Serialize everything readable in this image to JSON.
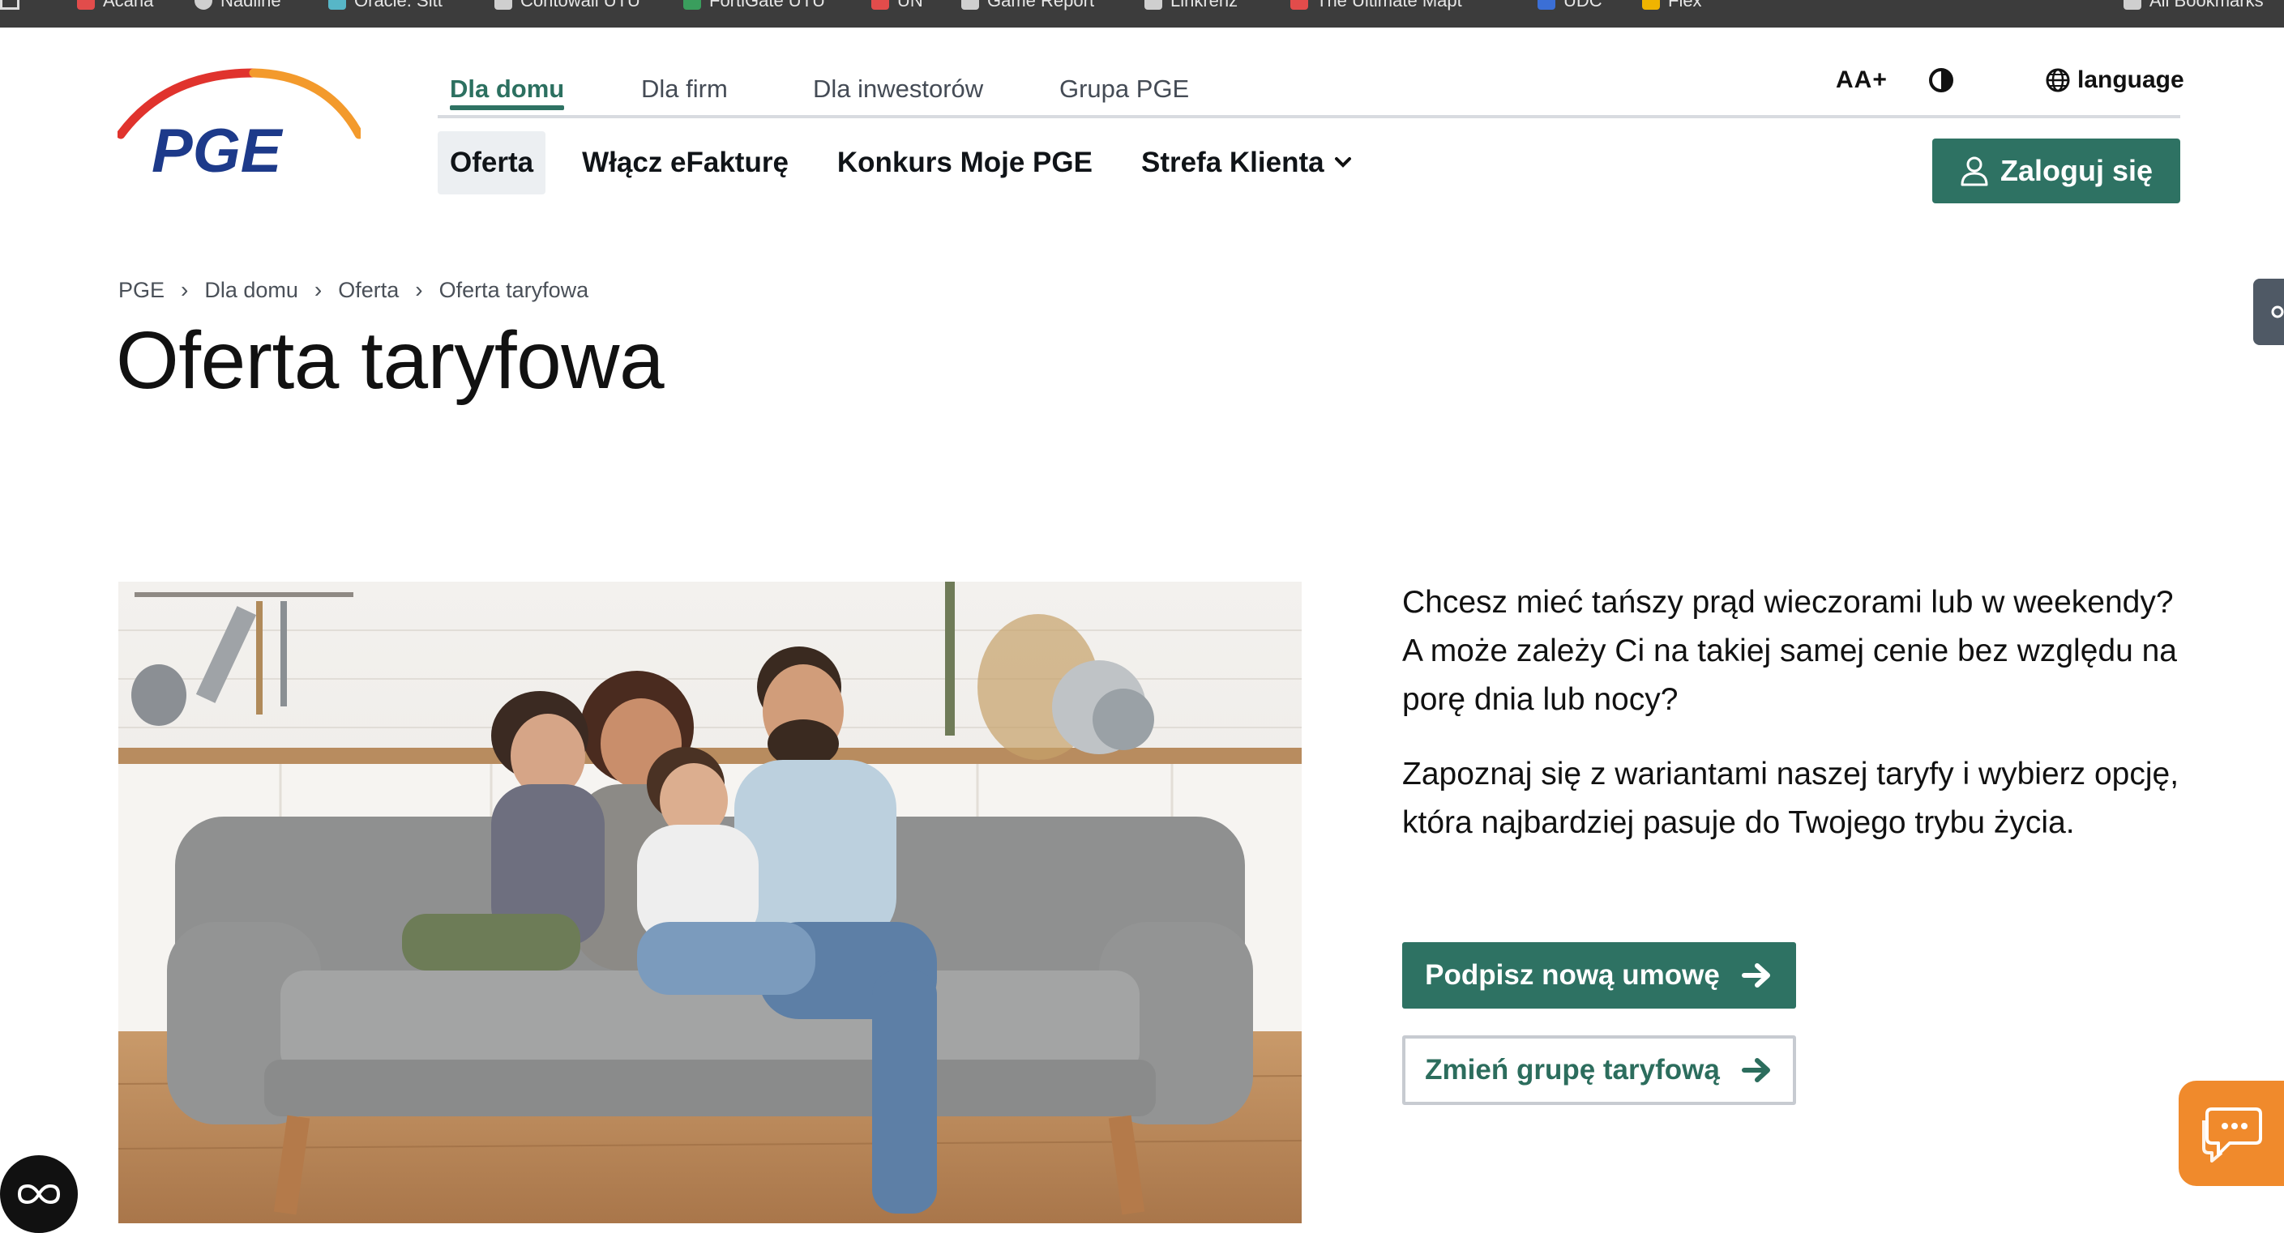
{
  "bookmarks": [
    {
      "label": "Acana",
      "color": "#e24c4b"
    },
    {
      "label": "Nadilne",
      "color": "#cfcfcf"
    },
    {
      "label": "Oracle. Sitt",
      "color": "#57b6c7"
    },
    {
      "label": "Contowall UTU",
      "color": "#cfcfcf"
    },
    {
      "label": "FortiGate UTU",
      "color": "#3a9e5d"
    },
    {
      "label": "UN",
      "color": "#e24c4b"
    },
    {
      "label": "Game Report",
      "color": "#cfcfcf"
    },
    {
      "label": "Linkrenz",
      "color": "#cfcfcf"
    },
    {
      "label": "The Ultimate Mapt",
      "color": "#e24c4b"
    },
    {
      "label": "UDC",
      "color": "#3b6fd6"
    },
    {
      "label": "Flex",
      "color": "#f0b400"
    },
    {
      "label": "All Bookmarks",
      "color": "#cfcfcf"
    }
  ],
  "logo": {
    "text": "PGE",
    "colors": {
      "arc_left": "#e0332d",
      "arc_right": "#f39a2c",
      "text": "#1d3a8a"
    }
  },
  "topnav": {
    "tabs": [
      {
        "label": "Dla domu",
        "active": true
      },
      {
        "label": "Dla firm",
        "active": false
      },
      {
        "label": "Dla inwestorów",
        "active": false
      },
      {
        "label": "Grupa PGE",
        "active": false
      }
    ]
  },
  "utility": {
    "font_size_label": "AA+",
    "language_label": "language"
  },
  "mainnav": {
    "items": [
      {
        "label": "Oferta",
        "selected": true
      },
      {
        "label": "Włącz eFakturę",
        "selected": false
      },
      {
        "label": "Konkurs Moje PGE",
        "selected": false
      },
      {
        "label": "Strefa Klienta",
        "selected": false,
        "dropdown": true
      }
    ]
  },
  "login_button": {
    "label": "Zaloguj się"
  },
  "breadcrumb": [
    "PGE",
    "Dla domu",
    "Oferta",
    "Oferta taryfowa"
  ],
  "page_title": "Oferta taryfowa",
  "intro": {
    "paragraph1": "Chcesz mieć tańszy prąd wieczorami lub w weekendy? A może zależy Ci na takiej samej cenie bez względu na porę dnia lub nocy?",
    "paragraph2": "Zapoznaj się z wariantami naszej taryfy i wybierz opcję, która najbardziej pasuje do Twojego trybu życia."
  },
  "buttons": {
    "primary": "Podpisz nową umowę",
    "secondary": "Zmień grupę taryfową"
  },
  "colors": {
    "brand_green": "#2e7263",
    "chat_orange": "#f08a2c"
  }
}
